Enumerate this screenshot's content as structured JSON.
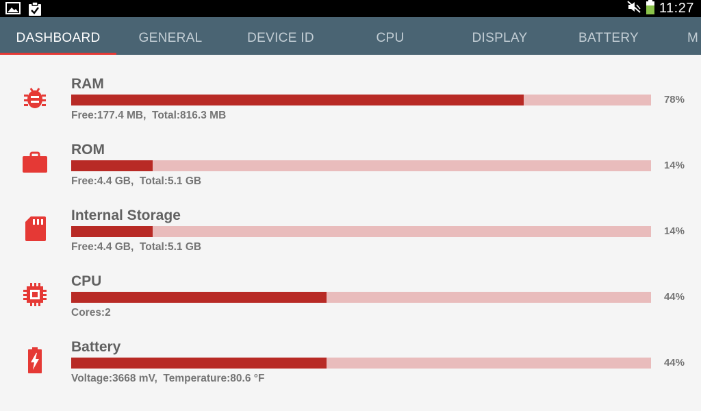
{
  "status_bar": {
    "time": "11:27",
    "icons": [
      "image-icon",
      "clipboard-check-icon",
      "mute-icon",
      "battery-icon"
    ],
    "battery_color": "#8bc34a"
  },
  "tabs": [
    {
      "label": "DASHBOARD",
      "active": true
    },
    {
      "label": "GENERAL"
    },
    {
      "label": "DEVICE ID"
    },
    {
      "label": "CPU"
    },
    {
      "label": "DISPLAY"
    },
    {
      "label": "BATTERY"
    },
    {
      "label": "M"
    }
  ],
  "colors": {
    "tab_bar": "#4a6473",
    "accent": "#e53935",
    "bar_fill": "#b82a25",
    "bar_track": "#e9bcbc",
    "icon": "#e53935"
  },
  "rows": [
    {
      "title": "RAM",
      "icon": "bug-icon",
      "percent": 78,
      "percent_label": "78%",
      "detail": "Free:177.4 MB,  Total:816.3 MB"
    },
    {
      "title": "ROM",
      "icon": "briefcase-icon",
      "percent": 14,
      "percent_label": "14%",
      "detail": "Free:4.4 GB,  Total:5.1 GB"
    },
    {
      "title": "Internal Storage",
      "icon": "sd-card-icon",
      "percent": 14,
      "percent_label": "14%",
      "detail": "Free:4.4 GB,  Total:5.1 GB"
    },
    {
      "title": "CPU",
      "icon": "chip-icon",
      "percent": 44,
      "percent_label": "44%",
      "detail": "Cores:2"
    },
    {
      "title": "Battery",
      "icon": "battery-charging-icon",
      "percent": 44,
      "percent_label": "44%",
      "detail": "Voltage:3668 mV,  Temperature:80.6 °F"
    }
  ]
}
